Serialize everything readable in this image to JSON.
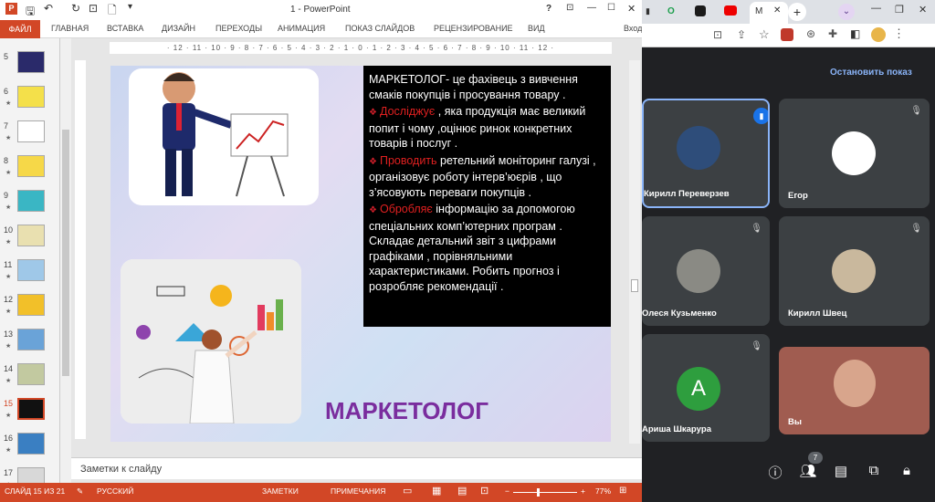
{
  "ppt": {
    "title": "1 - PowerPoint",
    "title_buttons": [
      "?",
      "⊡",
      "—",
      "☐",
      "✕"
    ],
    "tabs": [
      "ФАЙЛ",
      "ГЛАВНАЯ",
      "ВСТАВКА",
      "ДИЗАЙН",
      "ПЕРЕХОДЫ",
      "АНИМАЦИЯ",
      "ПОКАЗ СЛАЙДОВ",
      "РЕЦЕНЗИРОВАНИЕ",
      "ВИД",
      "Вход"
    ],
    "ruler": "· 12 · 11 · 10 · 9 · 8 · 7 · 6 · 5 · 4 · 3 · 2 · 1 · 0 · 1 · 2 · 3 · 4 · 5 · 6 · 7 · 8 · 9 · 10 · 11 · 12 ·",
    "thumbnails": [
      {
        "num": "5",
        "color": "#2a2a6a"
      },
      {
        "num": "6",
        "color": "#f4e04a"
      },
      {
        "num": "7",
        "color": "#ffffff"
      },
      {
        "num": "8",
        "color": "#f6d848"
      },
      {
        "num": "9",
        "color": "#3ab6c4"
      },
      {
        "num": "10",
        "color": "#e9e0b0"
      },
      {
        "num": "11",
        "color": "#9fc8e8"
      },
      {
        "num": "12",
        "color": "#f2c029"
      },
      {
        "num": "13",
        "color": "#6aa3d8"
      },
      {
        "num": "14",
        "color": "#c2c9a0"
      },
      {
        "num": "15",
        "color": "#111111"
      },
      {
        "num": "16",
        "color": "#3a7fc2"
      },
      {
        "num": "17",
        "color": "#d8d8d8"
      }
    ],
    "slide": {
      "paragraph1": "МАРКЕТОЛОГ- це фахівець з вивчення смаків покупців і просування товару .",
      "bullet1_red": "Досліджує",
      "bullet1_rest": " , яка продукція має великий попит і чому ,оцінює ринок конкретних товарів і послуг .",
      "bullet2_red": "Проводить",
      "bullet2_rest": " ретельний моніторинг галузі , організовує роботу інтерв’юєрів , що з’ясовують переваги покупців .",
      "bullet3_red": "Обробляє",
      "bullet3_rest": " інформацію за допомогою спеціальних комп’ютерних програм . Складає детальний звіт з цифрами графіками , порівняльними характеристиками. Робить прогноз і розробляє рекомендації .",
      "title": "МАРКЕТОЛОГ"
    },
    "notes_placeholder": "Заметки к слайду",
    "status": {
      "slide": "СЛАЙД 15 ИЗ 21",
      "lang": "РУССКИЙ",
      "notes": "ЗАМЕТКИ",
      "comments": "ПРИМЕЧАНИЯ",
      "zoom": "77%"
    }
  },
  "browser": {
    "tab_icons": [
      "O",
      "▶",
      "▶",
      "M"
    ],
    "active_tab_label": "M",
    "new_tab": "+"
  },
  "meet": {
    "stop_presenting": "Остановить показ",
    "participants": [
      {
        "name": "Кирилл Переверзев",
        "color": "#2e4d7a",
        "active": true
      },
      {
        "name": "Егор",
        "color": "#ffffff",
        "active": false
      },
      {
        "name": "Олеся Кузьменко",
        "color": "#8a8a84",
        "active": false
      },
      {
        "name": "Кирилл Швец",
        "color": "#c9b89d",
        "active": false
      },
      {
        "name": "Ариша Шкаруpa",
        "initial": "A",
        "color": "#2e9e3e",
        "active": false
      },
      {
        "name": "Вы",
        "color": "#a05c50",
        "active": false
      }
    ],
    "people_count": "7"
  }
}
